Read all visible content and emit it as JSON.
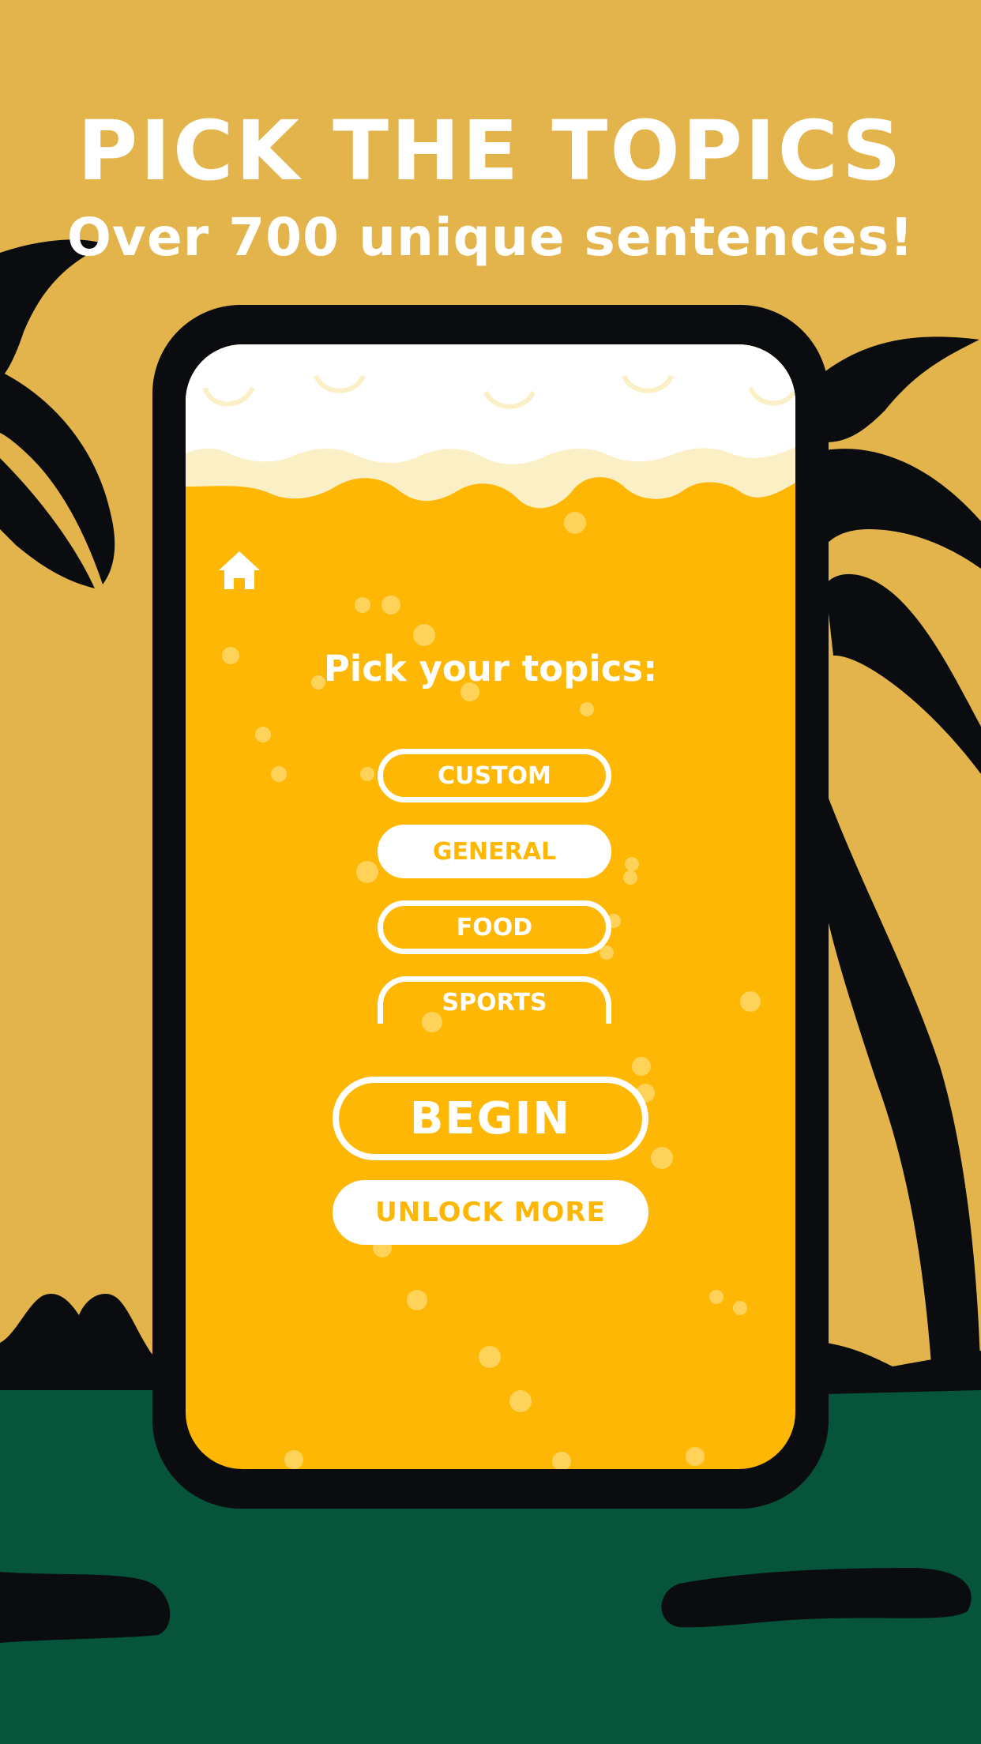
{
  "header": {
    "title": "PICK THE TOPICS",
    "subtitle": "Over 700 unique sentences!"
  },
  "screen": {
    "home_icon": "home-icon",
    "prompt": "Pick your topics:",
    "topics": [
      {
        "label": "CUSTOM",
        "selected": false
      },
      {
        "label": "GENERAL",
        "selected": true
      },
      {
        "label": "FOOD",
        "selected": false
      },
      {
        "label": "SPORTS",
        "selected": false
      }
    ],
    "begin_label": "BEGIN",
    "unlock_label": "UNLOCK MORE"
  },
  "colors": {
    "background": "#e3b44c",
    "ground": "#065439",
    "phone_frame": "#0b0c10",
    "beer": "#fdb704",
    "foam": "#ffffff",
    "foam_shadow": "#fbefc6"
  }
}
